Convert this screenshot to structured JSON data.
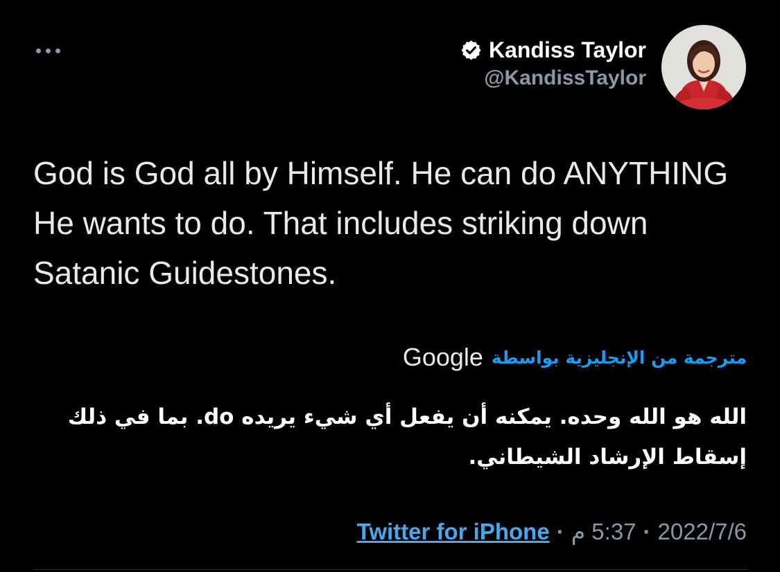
{
  "tweet": {
    "author": {
      "display_name": "Kandiss Taylor",
      "handle": "@KandissTaylor",
      "verified": true,
      "avatar_icon": "profile-photo"
    },
    "text": "God is God all by Himself. He can do ANYTHING He wants to do. That includes striking down Satanic Guidestones.",
    "translation": {
      "label": "مترجمة من الإنجليزية بواسطة",
      "provider": "Google",
      "text": "الله هو الله وحده. يمكنه أن يفعل أي شيء يريده do. بما في ذلك إسقاط الإرشاد الشيطاني."
    },
    "meta": {
      "date": "2022/7/6",
      "time": "5:37 م",
      "separator": "·",
      "source": "Twitter for iPhone"
    }
  },
  "icons": {
    "more": "more-dots-icon",
    "verified": "verified-badge-icon"
  },
  "colors": {
    "background": "#000000",
    "text": "#e7e9ea",
    "secondary": "#8b98a5",
    "link": "#1d9bf0"
  }
}
